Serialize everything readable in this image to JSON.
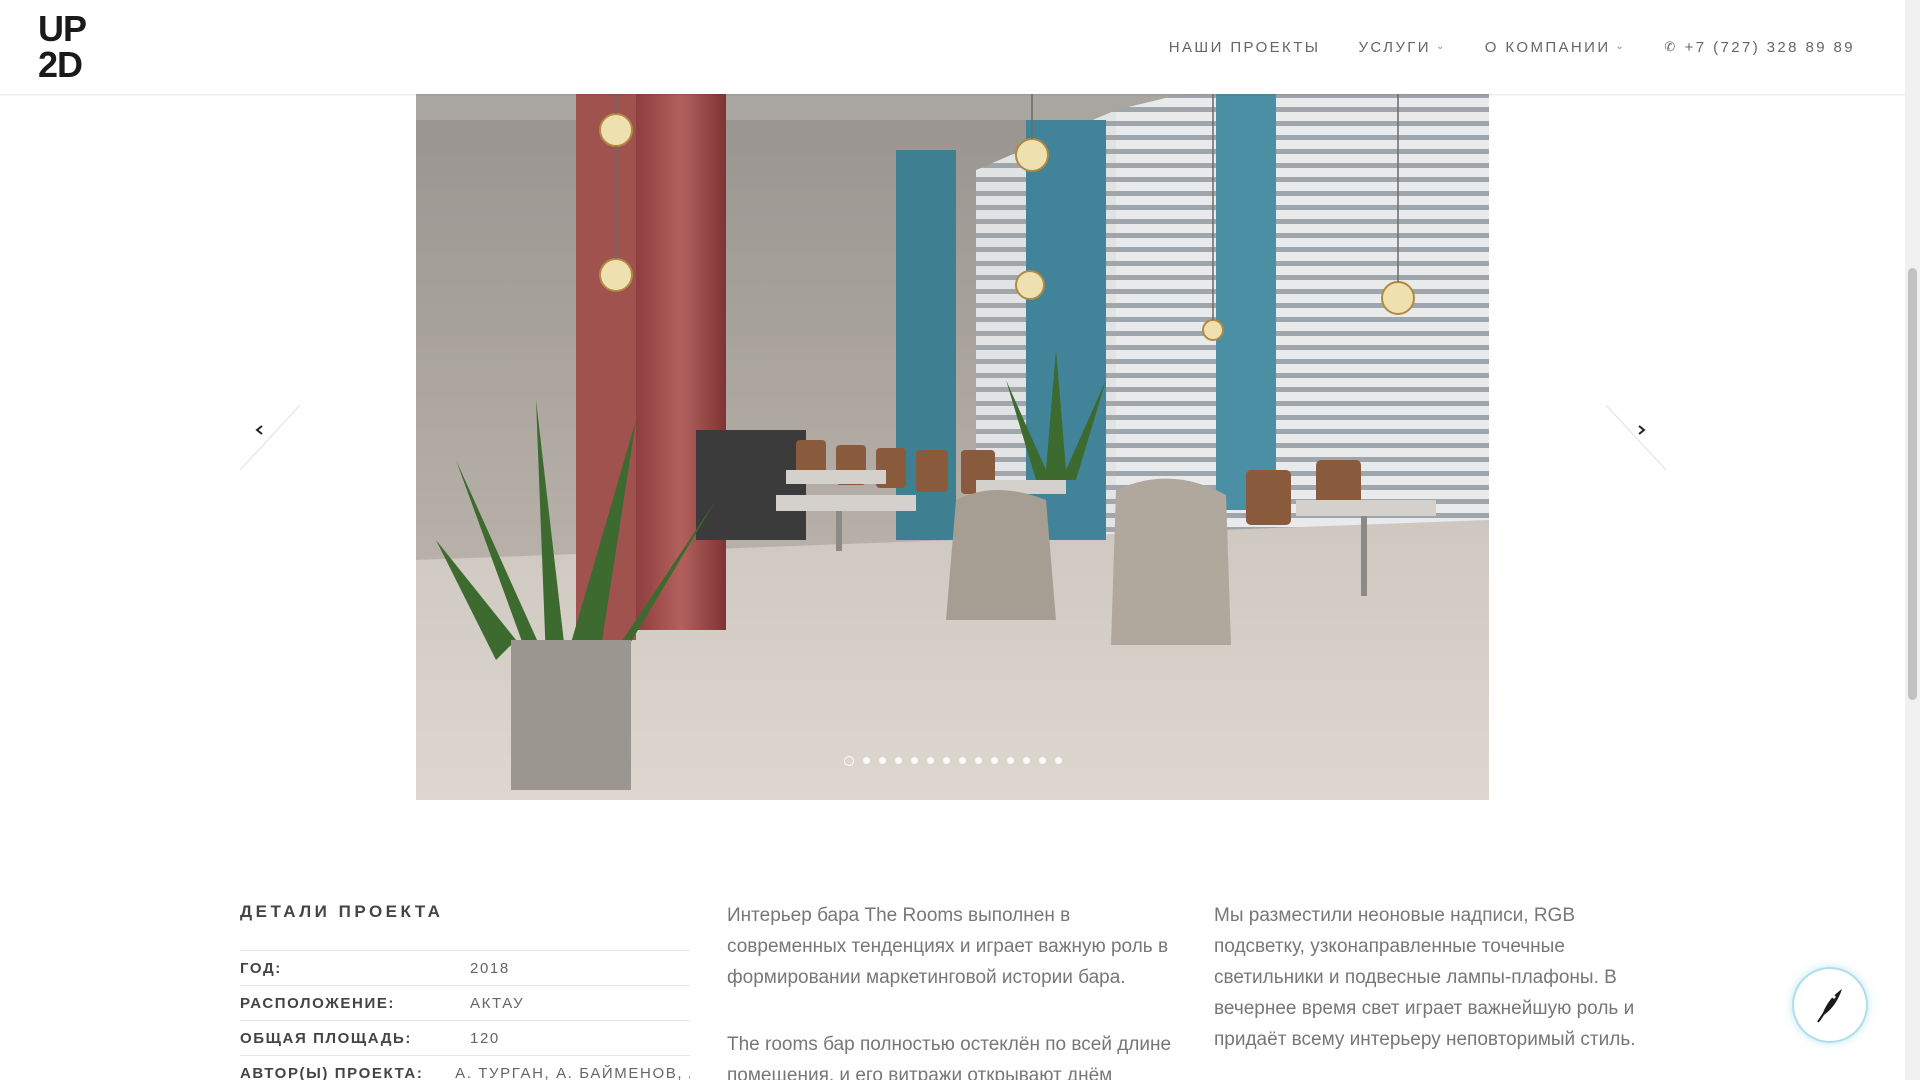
{
  "header": {
    "logo_top": "UP",
    "logo_bottom": "2D",
    "nav": [
      {
        "label": "НАШИ ПРОЕКТЫ",
        "dropdown": false
      },
      {
        "label": "УСЛУГИ",
        "dropdown": true
      },
      {
        "label": "О КОМПАНИИ",
        "dropdown": true
      }
    ],
    "phone": "+7 (727) 328 89 89",
    "phone_icon": "phone-icon",
    "chevron_icon": "chevron-down-icon"
  },
  "slider": {
    "image_description_icon": "restaurant-interior-photo",
    "slide_count": 14,
    "active_slide": 1,
    "prev_icon": "chevron-left-icon",
    "next_icon": "chevron-right-icon"
  },
  "details": {
    "title": "ДЕТАЛИ ПРОЕКТА",
    "rows": [
      {
        "key": "ГОД:",
        "value": "2018"
      },
      {
        "key": "РАСПОЛОЖЕНИЕ:",
        "value": "АКТАУ"
      },
      {
        "key": "ОБЩАЯ ПЛОЩАДЬ:",
        "value": "120"
      },
      {
        "key": "АВТОР(Ы) ПРОЕКТА:",
        "value": "А. ТУРГАН, А. БАЙМЕНОВ, А."
      }
    ]
  },
  "description": {
    "col1_p1": "Интерьер бара The Rooms выполнен в современных тенденциях и играет важную роль в формировании маркетинговой истории бара.",
    "col1_p2": "The rooms бар полностью остеклён по всей длине помещения, и его витражи открывают днём",
    "col2_p1": "Мы разместили неоновые надписи, RGB подсветку, узконаправленные точечные светильники и подвесные лампы-плафоны. В вечернее время свет играет важнейшую роль и придаёт всему интерьеру неповторимый стиль."
  },
  "badge": {
    "icon": "quill-pen-icon"
  },
  "colors": {
    "text": "#555555",
    "border": "#e5e5e5",
    "badge_glow": "#8cd2e1"
  }
}
